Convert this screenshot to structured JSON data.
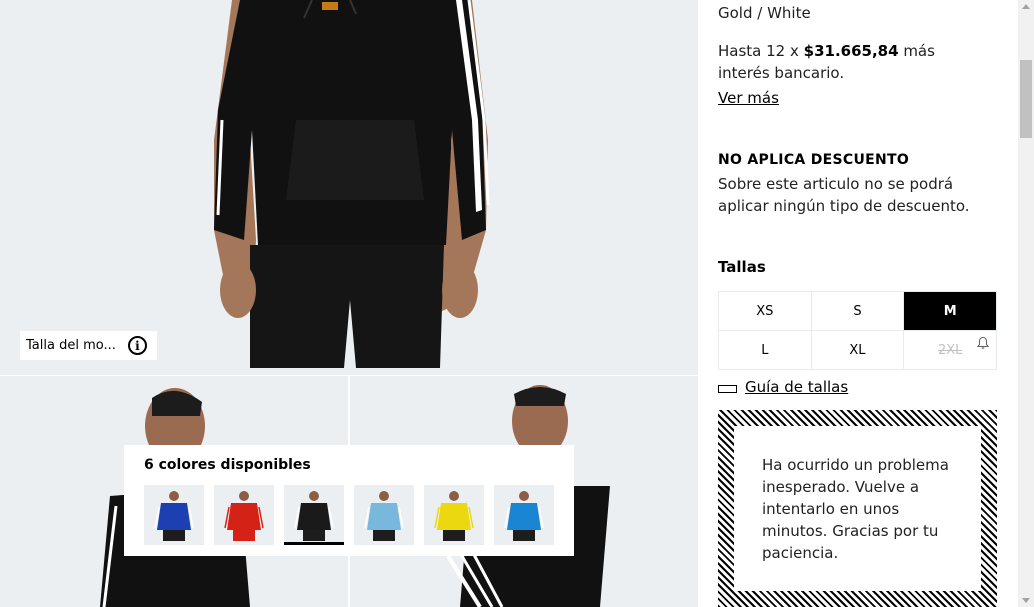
{
  "gallery": {
    "model_size_label": "Talla del mo...",
    "colors_title": "6 colores disponibles",
    "swatches": [
      {
        "color": "#1c3fb2",
        "name": "blue"
      },
      {
        "color": "#d42217",
        "name": "red"
      },
      {
        "color": "#1a1a1a",
        "name": "black",
        "selected": true
      },
      {
        "color": "#78b8dc",
        "name": "light-blue"
      },
      {
        "color": "#ecd80f",
        "name": "yellow"
      },
      {
        "color": "#1a86d3",
        "name": "sky-blue"
      }
    ]
  },
  "product": {
    "color_name": "Gold / White",
    "installments_prefix": "Hasta 12 x ",
    "installments_amount": "$31.665,84",
    "installments_suffix": " más interés bancario.",
    "ver_mas": "Ver más",
    "no_discount_title": "NO APLICA DESCUENTO",
    "no_discount_text": "Sobre este articulo no se podrá aplicar ningún tipo de descuento.",
    "sizes_title": "Tallas",
    "sizes": [
      "XS",
      "S",
      "M",
      "L",
      "XL",
      "2XL"
    ],
    "selected_size": "M",
    "size_guide": "Guía de tallas",
    "error_message": "Ha ocurrido un problema inesperado. Vuelve a intentarlo en unos minutos. Gracias por tu paciencia."
  }
}
